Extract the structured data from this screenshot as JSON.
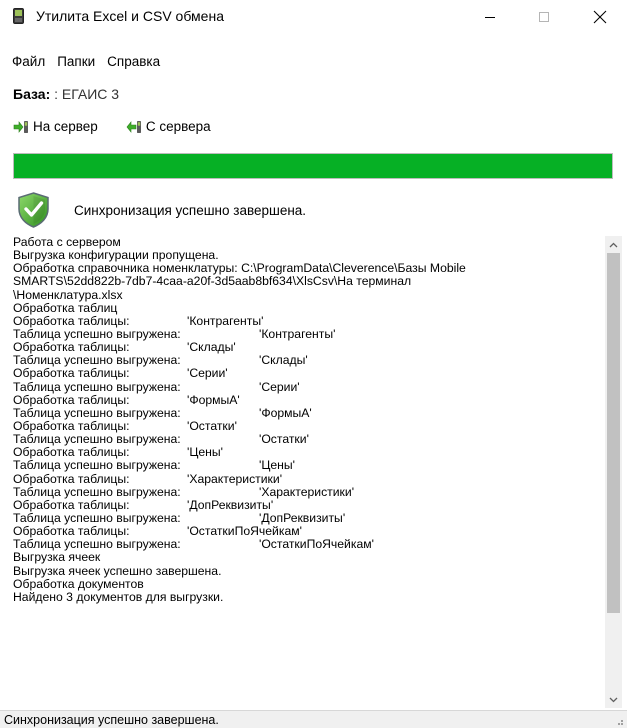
{
  "window": {
    "title": "Утилита Excel и CSV обмена",
    "minimize_glyph": "—",
    "maximize_glyph": "☐",
    "close_glyph": "✕"
  },
  "menu": {
    "items": [
      {
        "label": "Файл"
      },
      {
        "label": "Папки"
      },
      {
        "label": "Справка"
      }
    ]
  },
  "base": {
    "label": "База:",
    "value": " : ЕГАИС 3"
  },
  "toolbar": {
    "to_server_label": "На сервер",
    "from_server_label": "С сервера",
    "to_server_icon": "upload-arrow-icon",
    "from_server_icon": "download-arrow-icon"
  },
  "progress": {
    "value": 1.0,
    "color": "#06b025"
  },
  "status_message": {
    "icon": "security-shield-check-icon",
    "text": "Синхронизация успешно завершена."
  },
  "log": {
    "lines": [
      {
        "label": "Работа с сервером",
        "value": ""
      },
      {
        "label": "Выгрузка конфигурации пропущена.",
        "value": ""
      },
      {
        "label": "Обработка справочника номенклатуры: C:\\ProgramData\\Cleverence\\Базы Mobile",
        "value": ""
      },
      {
        "label": "SMARTS\\52dd822b-7db7-4caa-a20f-3d5aab8bf634\\XlsCsv\\На терминал",
        "value": ""
      },
      {
        "label": "\\Номенклатура.xlsx",
        "value": ""
      },
      {
        "label": "Обработка таблиц",
        "value": ""
      },
      {
        "label": "Обработка таблицы:",
        "value": "'Контрагенты'"
      },
      {
        "label": "Таблица успешно выгружена:",
        "value": "'Контрагенты'"
      },
      {
        "label": "Обработка таблицы:",
        "value": "'Склады'"
      },
      {
        "label": "Таблица успешно выгружена:",
        "value": "'Склады'"
      },
      {
        "label": "Обработка таблицы:",
        "value": "'Серии'"
      },
      {
        "label": "Таблица успешно выгружена:",
        "value": "'Серии'"
      },
      {
        "label": "Обработка таблицы:",
        "value": "'ФормыА'"
      },
      {
        "label": "Таблица успешно выгружена:",
        "value": "'ФормыА'"
      },
      {
        "label": "Обработка таблицы:",
        "value": "'Остатки'"
      },
      {
        "label": "Таблица успешно выгружена:",
        "value": "'Остатки'"
      },
      {
        "label": "Обработка таблицы:",
        "value": "'Цены'"
      },
      {
        "label": "Таблица успешно выгружена:",
        "value": "'Цены'"
      },
      {
        "label": "Обработка таблицы:",
        "value": "'Характеристики'"
      },
      {
        "label": "Таблица успешно выгружена:",
        "value": "'Характеристики'"
      },
      {
        "label": "Обработка таблицы:",
        "value": "'ДопРеквизиты'"
      },
      {
        "label": "Таблица успешно выгружена:",
        "value": "'ДопРеквизиты'"
      },
      {
        "label": "Обработка таблицы:",
        "value": "'ОстаткиПоЯчейкам'"
      },
      {
        "label": "Таблица успешно выгружена:",
        "value": "'ОстаткиПоЯчейкам'"
      },
      {
        "label": "Выгрузка ячеек",
        "value": ""
      },
      {
        "label": "Выгрузка ячеек успешно завершена.",
        "value": ""
      },
      {
        "label": "Обработка документов",
        "value": ""
      },
      {
        "label": "Найдено 3 документов для выгрузки.",
        "value": ""
      }
    ]
  },
  "statusbar": {
    "text": "Синхронизация успешно завершена."
  }
}
